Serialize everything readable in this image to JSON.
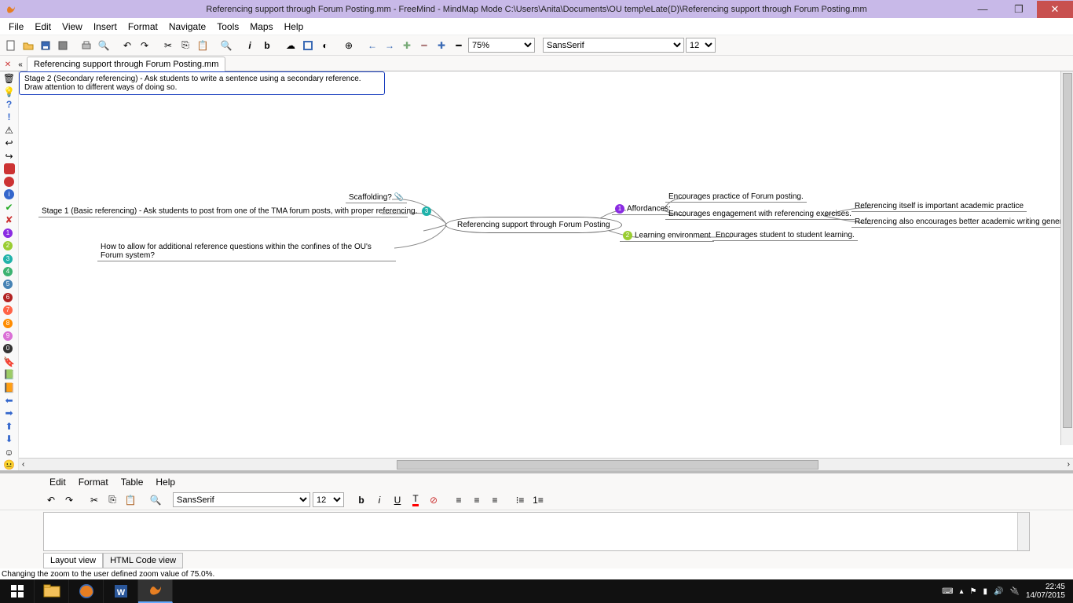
{
  "title": "Referencing support through Forum Posting.mm - FreeMind - MindMap Mode C:\\Users\\Anita\\Documents\\OU temp\\eLate(D)\\Referencing support through Forum Posting.mm",
  "menubar": [
    "File",
    "Edit",
    "View",
    "Insert",
    "Format",
    "Navigate",
    "Tools",
    "Maps",
    "Help"
  ],
  "zoom": "75%",
  "font": "SansSerif",
  "fontsize": "12",
  "tab": "Referencing support through Forum Posting.mm",
  "tabclose": "✕",
  "tabnav": "«",
  "mindmap": {
    "root": "Referencing support through Forum Posting",
    "left": {
      "scaffold": "Scaffolding?",
      "stage1": "Stage 1 (Basic referencing) - Ask students to post from one of the TMA forum posts, with proper referencing.",
      "stage2": "Stage 2 (Secondary referencing) - Ask students to write a sentence using a secondary reference. Draw attention to different ways of doing so.",
      "howallow": "How to allow for additional reference questions within the confines of the OU's Forum system?"
    },
    "right": {
      "afford": "Affordances:",
      "a1": "Encourages practice of Forum posting.",
      "a2": "Encourages engagement with referencing exercises.",
      "a21": "Referencing itself is important academic practice",
      "a22": "Referencing also encourages better academic writing generally",
      "learn": "Learning environment",
      "l1": "Encourages student to student learning."
    }
  },
  "editor": {
    "menu": [
      "Edit",
      "Format",
      "Table",
      "Help"
    ],
    "font": "SansSerif",
    "size": "12",
    "tabs": {
      "layout": "Layout view",
      "html": "HTML Code view"
    }
  },
  "status": "Changing the zoom to the user defined zoom value of 75.0%.",
  "tray": {
    "time": "22:45",
    "date": "14/07/2015"
  }
}
